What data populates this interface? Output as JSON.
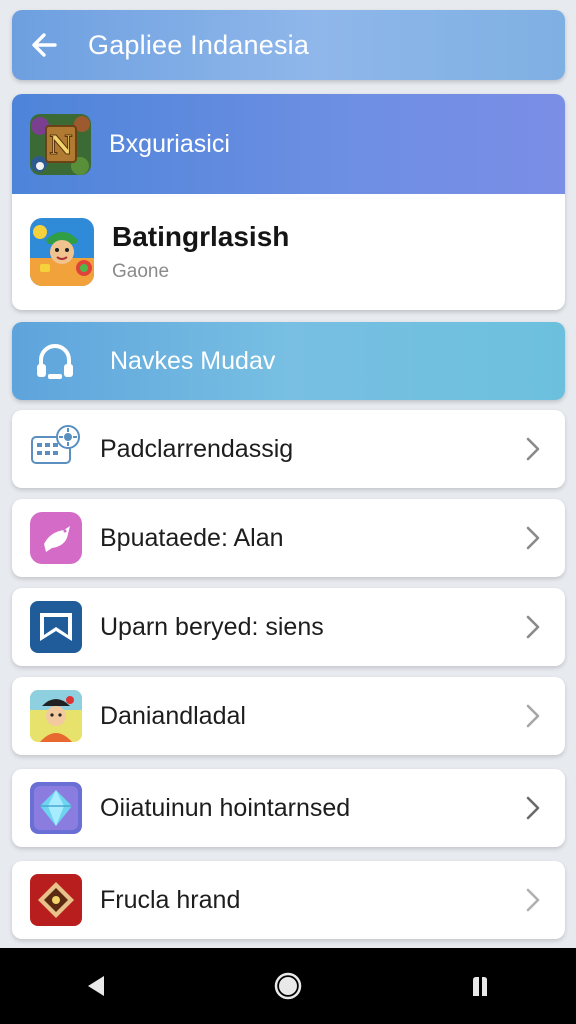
{
  "appbar": {
    "title": "Gapliee Indanesia",
    "back_icon": "arrow-left-icon"
  },
  "featured": {
    "header_label": "Bxguriasici",
    "title": "Batingrlasish",
    "subtitle": "Gaone"
  },
  "section": {
    "label": "Navkes Mudav",
    "icon": "headset-icon"
  },
  "rows": [
    {
      "label": "Padclarrendassig"
    },
    {
      "label": "Bpuataede: Alan"
    },
    {
      "label": "Uparn beryed: siens"
    },
    {
      "label": "Daniandladal"
    },
    {
      "label": "Oiiatuinun hointarnsed"
    },
    {
      "label": "Frucla hrand"
    }
  ],
  "navbar": {
    "back": "back-triangle-icon",
    "home": "home-circle-icon",
    "recents": "recents-icon"
  },
  "colors": {
    "accent": "#6d9fe0",
    "section": "#78bfe3",
    "nav": "#000000"
  }
}
